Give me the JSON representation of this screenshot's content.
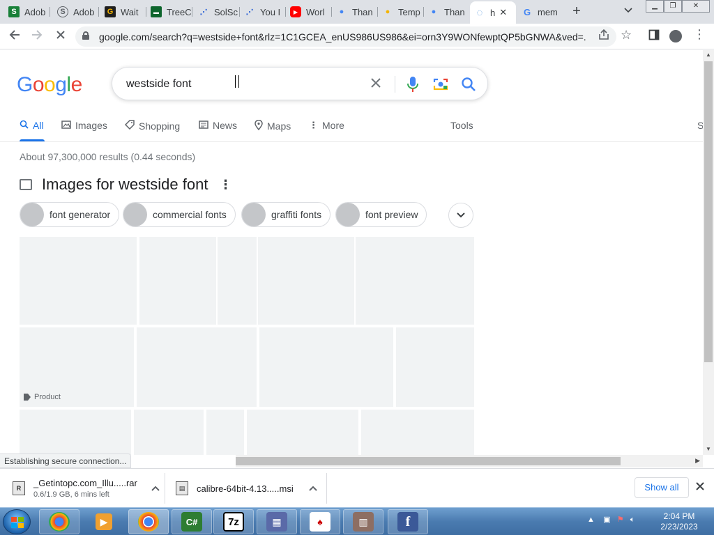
{
  "browser": {
    "tabs": [
      {
        "label": "Adob",
        "icon": "sheets-icon",
        "color": "#188038",
        "glyph": "S"
      },
      {
        "label": "Adob",
        "icon": "spiral-icon",
        "color": "#5f6368",
        "glyph": "S"
      },
      {
        "label": "Wait",
        "icon": "g-icon",
        "color": "#1f1f1f",
        "glyph": "G"
      },
      {
        "label": "TreeC",
        "icon": "tree-icon",
        "color": "#0d652d",
        "glyph": "▬"
      },
      {
        "label": "SolSc",
        "icon": "solutions-icon",
        "color": "#3367d6",
        "glyph": "⋰"
      },
      {
        "label": "You I",
        "icon": "solutions-icon",
        "color": "#3367d6",
        "glyph": "⋰"
      },
      {
        "label": "Worl",
        "icon": "youtube-icon",
        "color": "#ff0000",
        "glyph": "▶"
      },
      {
        "label": "Than",
        "icon": "globe-icon",
        "color": "#4285f4",
        "glyph": "●"
      },
      {
        "label": "Temp",
        "icon": "tempt-icon",
        "color": "#f4b400",
        "glyph": "●"
      },
      {
        "label": "Than",
        "icon": "globe-icon",
        "color": "#4285f4",
        "glyph": "●"
      },
      {
        "label": "h",
        "icon": "loading-icon",
        "color": "#5f9de0",
        "glyph": "◌",
        "active": true
      },
      {
        "label": "mem",
        "icon": "google-icon",
        "color": "#4285f4",
        "glyph": "G"
      }
    ],
    "new_tab": "+",
    "tab_search": "⌄",
    "url": "google.com/search?q=westside+font&rlz=1C1GCEA_enUS986US986&ei=orn3Y9WONfewptQP5bGNWA&ved=..."
  },
  "search": {
    "logo": [
      "G",
      "o",
      "o",
      "g",
      "l",
      "e"
    ],
    "logo_colors": [
      "#4285f4",
      "#ea4335",
      "#fbbc05",
      "#4285f4",
      "#34a853",
      "#ea4335"
    ],
    "query": "westside font"
  },
  "nav": {
    "tabs": [
      "All",
      "Images",
      "Shopping",
      "News",
      "Maps",
      "More"
    ],
    "tools": "Tools",
    "cut_off": "S"
  },
  "results": {
    "stats": "About 97,300,000 results (0.44 seconds)",
    "images_heading": "Images for westside font",
    "chips": [
      "font generator",
      "commercial fonts",
      "graffiti fonts",
      "font preview"
    ],
    "product_tag": "Product"
  },
  "status": "Establishing secure connection...",
  "downloads": [
    {
      "name": "_Getintopc.com_Illu.....rar",
      "progress": "0.6/1.9 GB, 6 mins left"
    },
    {
      "name": "calibre-64bit-4.13.....msi",
      "progress": ""
    }
  ],
  "show_all": "Show all",
  "taskbar": {
    "apps": [
      "chrome-arrow-icon",
      "media-player-icon",
      "chrome-icon",
      "csharp-icon",
      "7zip-icon",
      "installer-icon",
      "solitaire-icon",
      "library-icon",
      "facebook-icon"
    ],
    "csharp": "C#",
    "sevenzip": "7z",
    "facebook": "f",
    "time": "2:04 PM",
    "date": "2/23/2023"
  },
  "colors": {
    "accent": "#1a73e8",
    "tab_strip": "#dee1e6"
  }
}
